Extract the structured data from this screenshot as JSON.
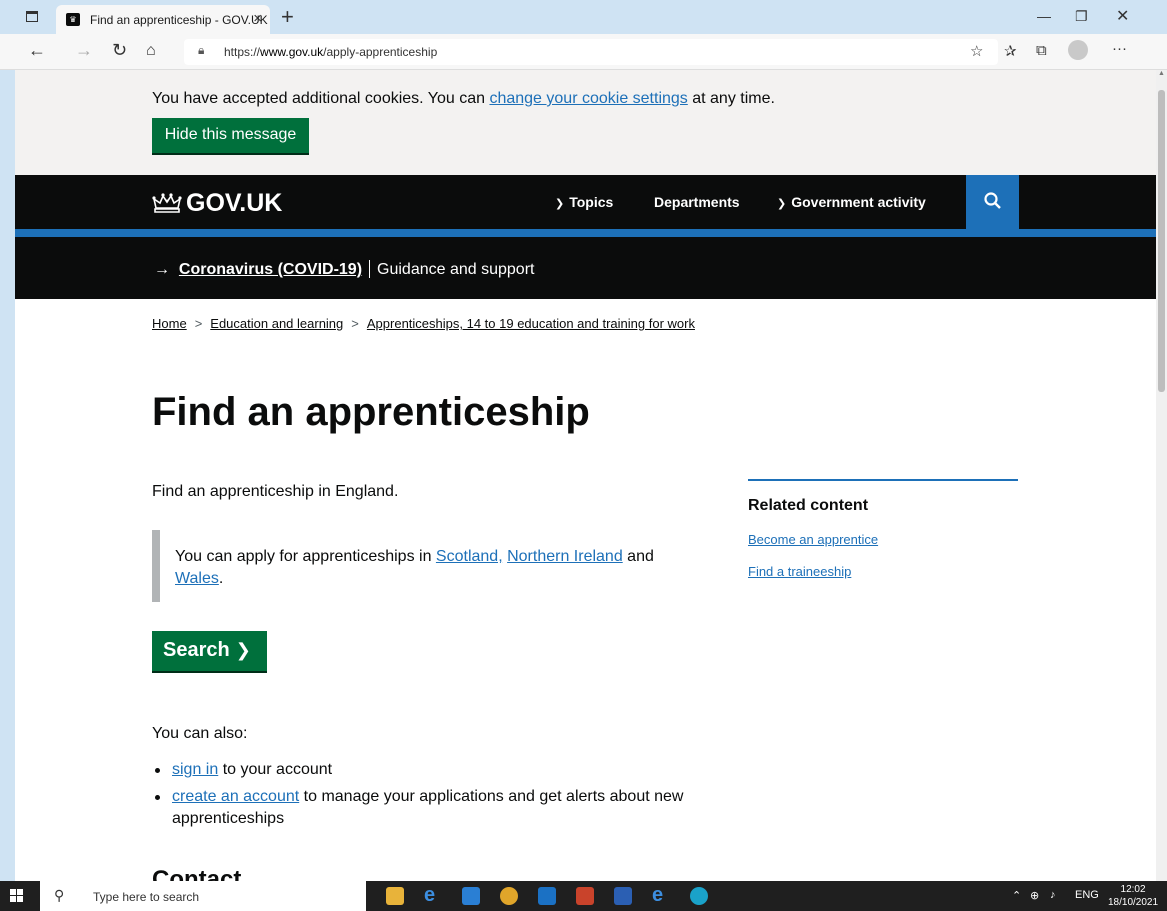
{
  "browser": {
    "tab_title": "Find an apprenticeship - GOV.UK",
    "url_prefix": "https://",
    "url_domain": "www.gov.uk",
    "url_path": "/apply-apprenticeship"
  },
  "cookie_banner": {
    "text_before": "You have accepted additional cookies. You can ",
    "link": "change your cookie settings",
    "text_after": " at any time.",
    "hide_button": "Hide this message"
  },
  "header": {
    "logo": "GOV.UK",
    "menu": [
      "Topics",
      "Departments",
      "Government activity"
    ]
  },
  "covid_banner": {
    "link": "Coronavirus (COVID-19)",
    "text": "Guidance and support"
  },
  "breadcrumb": [
    "Home",
    "Education and learning",
    "Apprenticeships, 14 to 19 education and training for work"
  ],
  "main": {
    "title": "Find an apprenticeship",
    "lede": "Find an apprenticeship in England.",
    "inset_text": "You can apply for apprenticeships in ",
    "inset_links": [
      "Scotland,",
      "Northern Ireland",
      "Wales"
    ],
    "inset_and": " and ",
    "inset_end": ".",
    "search_button": "Search",
    "also_text": "You can also:",
    "list": [
      {
        "link": "sign in",
        "text": " to your account"
      },
      {
        "link": "create an account",
        "text": " to manage your applications and get alerts about new apprenticeships"
      }
    ],
    "contact_heading": "Contact"
  },
  "related": {
    "title": "Related content",
    "links": [
      "Become an apprentice",
      "Find a traineeship"
    ]
  },
  "taskbar": {
    "search_placeholder": "Type here to search",
    "language": "ENG",
    "time": "12:02",
    "date": "18/10/2021"
  },
  "colors": {
    "govuk_black": "#0b0c0c",
    "govuk_blue": "#1d70b8",
    "govuk_green": "#00703c",
    "cookie_bg": "#f3f2f1"
  }
}
